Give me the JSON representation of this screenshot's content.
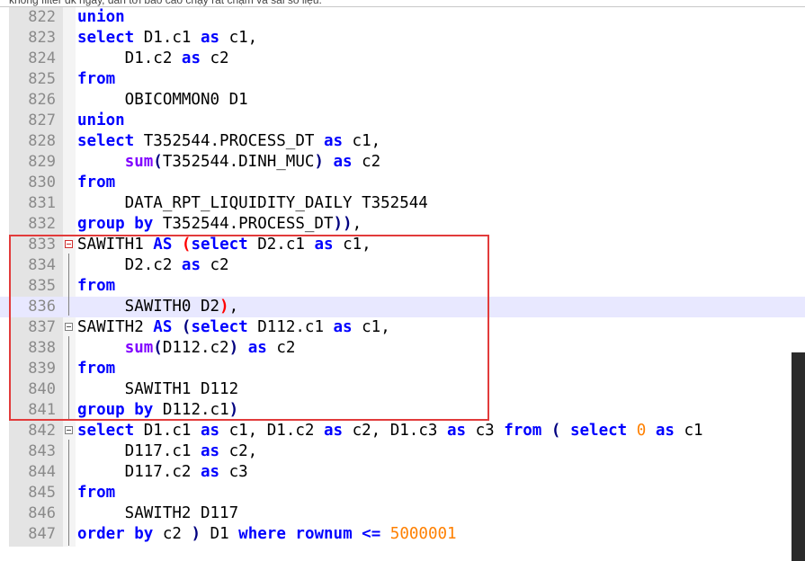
{
  "caption": "không filter dk ngày, dẫn tới báo cáo chạy rất chậm và sai số liệu.",
  "lines": [
    {
      "n": "822",
      "tokens": [
        {
          "t": "union",
          "c": "kw"
        }
      ]
    },
    {
      "n": "823",
      "tokens": [
        {
          "t": "select",
          "c": "kw"
        },
        {
          "t": " D1.c1 ",
          "c": ""
        },
        {
          "t": "as",
          "c": "kw"
        },
        {
          "t": " c1,",
          "c": ""
        }
      ]
    },
    {
      "n": "824",
      "tokens": [
        {
          "t": "     D1.c2 ",
          "c": ""
        },
        {
          "t": "as",
          "c": "kw"
        },
        {
          "t": " c2",
          "c": ""
        }
      ]
    },
    {
      "n": "825",
      "tokens": [
        {
          "t": "from",
          "c": "kw"
        }
      ]
    },
    {
      "n": "826",
      "tokens": [
        {
          "t": "     OBICOMMON0 D1",
          "c": ""
        }
      ]
    },
    {
      "n": "827",
      "tokens": [
        {
          "t": "union",
          "c": "kw"
        }
      ]
    },
    {
      "n": "828",
      "tokens": [
        {
          "t": "select",
          "c": "kw"
        },
        {
          "t": " T352544.PROCESS_DT ",
          "c": ""
        },
        {
          "t": "as",
          "c": "kw"
        },
        {
          "t": " c1,",
          "c": ""
        }
      ]
    },
    {
      "n": "829",
      "tokens": [
        {
          "t": "     ",
          "c": ""
        },
        {
          "t": "sum",
          "c": "fn"
        },
        {
          "t": "(",
          "c": "par"
        },
        {
          "t": "T352544.DINH_MUC",
          "c": ""
        },
        {
          "t": ")",
          "c": "par"
        },
        {
          "t": " ",
          "c": ""
        },
        {
          "t": "as",
          "c": "kw"
        },
        {
          "t": " c2",
          "c": ""
        }
      ]
    },
    {
      "n": "830",
      "tokens": [
        {
          "t": "from",
          "c": "kw"
        }
      ]
    },
    {
      "n": "831",
      "tokens": [
        {
          "t": "     DATA_RPT_LIQUIDITY_DAILY T352544",
          "c": ""
        }
      ]
    },
    {
      "n": "832",
      "tokens": [
        {
          "t": "group",
          "c": "kw"
        },
        {
          "t": " ",
          "c": ""
        },
        {
          "t": "by",
          "c": "kw"
        },
        {
          "t": " T352544.PROCESS_DT",
          "c": ""
        },
        {
          "t": "))",
          "c": "par"
        },
        {
          "t": ",",
          "c": ""
        }
      ]
    },
    {
      "n": "833",
      "fold": "red",
      "tokens": [
        {
          "t": "SAWITH1 ",
          "c": ""
        },
        {
          "t": "AS",
          "c": "kw"
        },
        {
          "t": " ",
          "c": ""
        },
        {
          "t": "(",
          "c": "red"
        },
        {
          "t": "select",
          "c": "kw"
        },
        {
          "t": " D2.c1 ",
          "c": ""
        },
        {
          "t": "as",
          "c": "kw"
        },
        {
          "t": " c1,",
          "c": ""
        }
      ]
    },
    {
      "n": "834",
      "tokens": [
        {
          "t": "     D2.c2 ",
          "c": ""
        },
        {
          "t": "as",
          "c": "kw"
        },
        {
          "t": " c2",
          "c": ""
        }
      ]
    },
    {
      "n": "835",
      "tokens": [
        {
          "t": "from",
          "c": "kw"
        }
      ]
    },
    {
      "n": "836",
      "hl": true,
      "tokens": [
        {
          "t": "     SAWITH0 D2",
          "c": ""
        },
        {
          "t": ")",
          "c": "red"
        },
        {
          "t": ",",
          "c": ""
        }
      ]
    },
    {
      "n": "837",
      "fold": "gray",
      "tokens": [
        {
          "t": "SAWITH2 ",
          "c": ""
        },
        {
          "t": "AS",
          "c": "kw"
        },
        {
          "t": " ",
          "c": ""
        },
        {
          "t": "(",
          "c": "par"
        },
        {
          "t": "select",
          "c": "kw"
        },
        {
          "t": " D112.c1 ",
          "c": ""
        },
        {
          "t": "as",
          "c": "kw"
        },
        {
          "t": " c1,",
          "c": ""
        }
      ]
    },
    {
      "n": "838",
      "tokens": [
        {
          "t": "     ",
          "c": ""
        },
        {
          "t": "sum",
          "c": "fn"
        },
        {
          "t": "(",
          "c": "par"
        },
        {
          "t": "D112.c2",
          "c": ""
        },
        {
          "t": ")",
          "c": "par"
        },
        {
          "t": " ",
          "c": ""
        },
        {
          "t": "as",
          "c": "kw"
        },
        {
          "t": " c2",
          "c": ""
        }
      ]
    },
    {
      "n": "839",
      "tokens": [
        {
          "t": "from",
          "c": "kw"
        }
      ]
    },
    {
      "n": "840",
      "tokens": [
        {
          "t": "     SAWITH1 D112",
          "c": ""
        }
      ]
    },
    {
      "n": "841",
      "tokens": [
        {
          "t": "group",
          "c": "kw"
        },
        {
          "t": " ",
          "c": ""
        },
        {
          "t": "by",
          "c": "kw"
        },
        {
          "t": " D112.c1",
          "c": ""
        },
        {
          "t": ")",
          "c": "par"
        }
      ]
    },
    {
      "n": "842",
      "fold": "gray",
      "tokens": [
        {
          "t": "select",
          "c": "kw"
        },
        {
          "t": " D1.c1 ",
          "c": ""
        },
        {
          "t": "as",
          "c": "kw"
        },
        {
          "t": " c1, D1.c2 ",
          "c": ""
        },
        {
          "t": "as",
          "c": "kw"
        },
        {
          "t": " c2, D1.c3 ",
          "c": ""
        },
        {
          "t": "as",
          "c": "kw"
        },
        {
          "t": " c3 ",
          "c": ""
        },
        {
          "t": "from",
          "c": "kw"
        },
        {
          "t": " ",
          "c": ""
        },
        {
          "t": "(",
          "c": "par"
        },
        {
          "t": " ",
          "c": ""
        },
        {
          "t": "select",
          "c": "kw"
        },
        {
          "t": " ",
          "c": ""
        },
        {
          "t": "0",
          "c": "num"
        },
        {
          "t": " ",
          "c": ""
        },
        {
          "t": "as",
          "c": "kw"
        },
        {
          "t": " c1",
          "c": ""
        }
      ]
    },
    {
      "n": "843",
      "tokens": [
        {
          "t": "     D117.c1 ",
          "c": ""
        },
        {
          "t": "as",
          "c": "kw"
        },
        {
          "t": " c2,",
          "c": ""
        }
      ]
    },
    {
      "n": "844",
      "tokens": [
        {
          "t": "     D117.c2 ",
          "c": ""
        },
        {
          "t": "as",
          "c": "kw"
        },
        {
          "t": " c3",
          "c": ""
        }
      ]
    },
    {
      "n": "845",
      "tokens": [
        {
          "t": "from",
          "c": "kw"
        }
      ]
    },
    {
      "n": "846",
      "tokens": [
        {
          "t": "     SAWITH2 D117",
          "c": ""
        }
      ]
    },
    {
      "n": "847",
      "tokens": [
        {
          "t": "order",
          "c": "kw"
        },
        {
          "t": " ",
          "c": ""
        },
        {
          "t": "by",
          "c": "kw"
        },
        {
          "t": " c2 ",
          "c": ""
        },
        {
          "t": ")",
          "c": "par"
        },
        {
          "t": " D1 ",
          "c": ""
        },
        {
          "t": "where",
          "c": "kw"
        },
        {
          "t": " ",
          "c": ""
        },
        {
          "t": "rownum",
          "c": "kw"
        },
        {
          "t": " ",
          "c": ""
        },
        {
          "t": "<=",
          "c": "kw"
        },
        {
          "t": " ",
          "c": ""
        },
        {
          "t": "5000001",
          "c": "num"
        }
      ]
    }
  ]
}
